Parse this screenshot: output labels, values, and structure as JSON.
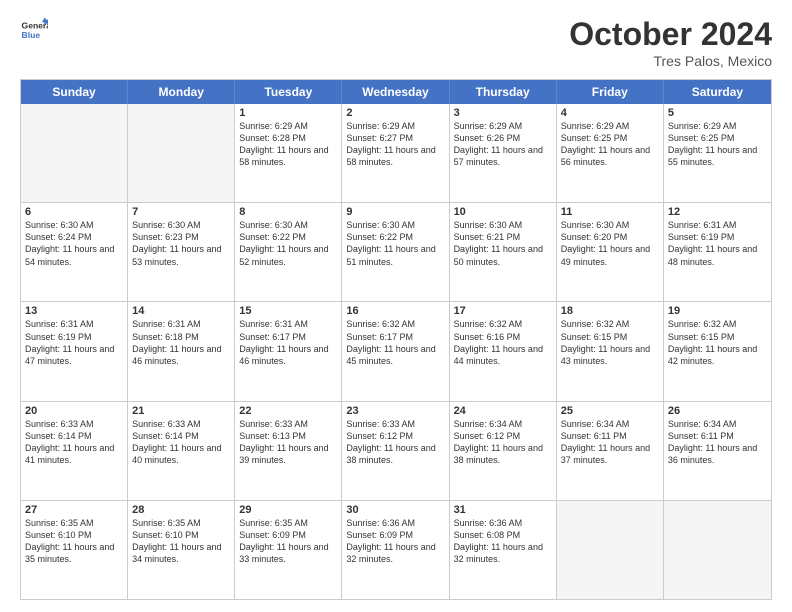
{
  "header": {
    "logo_line1": "General",
    "logo_line2": "Blue",
    "month": "October 2024",
    "location": "Tres Palos, Mexico"
  },
  "day_headers": [
    "Sunday",
    "Monday",
    "Tuesday",
    "Wednesday",
    "Thursday",
    "Friday",
    "Saturday"
  ],
  "weeks": [
    [
      {
        "num": "",
        "empty": true
      },
      {
        "num": "",
        "empty": true
      },
      {
        "num": "1",
        "rise": "6:29 AM",
        "set": "6:28 PM",
        "daylight": "11 hours and 58 minutes."
      },
      {
        "num": "2",
        "rise": "6:29 AM",
        "set": "6:27 PM",
        "daylight": "11 hours and 58 minutes."
      },
      {
        "num": "3",
        "rise": "6:29 AM",
        "set": "6:26 PM",
        "daylight": "11 hours and 57 minutes."
      },
      {
        "num": "4",
        "rise": "6:29 AM",
        "set": "6:25 PM",
        "daylight": "11 hours and 56 minutes."
      },
      {
        "num": "5",
        "rise": "6:29 AM",
        "set": "6:25 PM",
        "daylight": "11 hours and 55 minutes."
      }
    ],
    [
      {
        "num": "6",
        "rise": "6:30 AM",
        "set": "6:24 PM",
        "daylight": "11 hours and 54 minutes."
      },
      {
        "num": "7",
        "rise": "6:30 AM",
        "set": "6:23 PM",
        "daylight": "11 hours and 53 minutes."
      },
      {
        "num": "8",
        "rise": "6:30 AM",
        "set": "6:22 PM",
        "daylight": "11 hours and 52 minutes."
      },
      {
        "num": "9",
        "rise": "6:30 AM",
        "set": "6:22 PM",
        "daylight": "11 hours and 51 minutes."
      },
      {
        "num": "10",
        "rise": "6:30 AM",
        "set": "6:21 PM",
        "daylight": "11 hours and 50 minutes."
      },
      {
        "num": "11",
        "rise": "6:30 AM",
        "set": "6:20 PM",
        "daylight": "11 hours and 49 minutes."
      },
      {
        "num": "12",
        "rise": "6:31 AM",
        "set": "6:19 PM",
        "daylight": "11 hours and 48 minutes."
      }
    ],
    [
      {
        "num": "13",
        "rise": "6:31 AM",
        "set": "6:19 PM",
        "daylight": "11 hours and 47 minutes."
      },
      {
        "num": "14",
        "rise": "6:31 AM",
        "set": "6:18 PM",
        "daylight": "11 hours and 46 minutes."
      },
      {
        "num": "15",
        "rise": "6:31 AM",
        "set": "6:17 PM",
        "daylight": "11 hours and 46 minutes."
      },
      {
        "num": "16",
        "rise": "6:32 AM",
        "set": "6:17 PM",
        "daylight": "11 hours and 45 minutes."
      },
      {
        "num": "17",
        "rise": "6:32 AM",
        "set": "6:16 PM",
        "daylight": "11 hours and 44 minutes."
      },
      {
        "num": "18",
        "rise": "6:32 AM",
        "set": "6:15 PM",
        "daylight": "11 hours and 43 minutes."
      },
      {
        "num": "19",
        "rise": "6:32 AM",
        "set": "6:15 PM",
        "daylight": "11 hours and 42 minutes."
      }
    ],
    [
      {
        "num": "20",
        "rise": "6:33 AM",
        "set": "6:14 PM",
        "daylight": "11 hours and 41 minutes."
      },
      {
        "num": "21",
        "rise": "6:33 AM",
        "set": "6:14 PM",
        "daylight": "11 hours and 40 minutes."
      },
      {
        "num": "22",
        "rise": "6:33 AM",
        "set": "6:13 PM",
        "daylight": "11 hours and 39 minutes."
      },
      {
        "num": "23",
        "rise": "6:33 AM",
        "set": "6:12 PM",
        "daylight": "11 hours and 38 minutes."
      },
      {
        "num": "24",
        "rise": "6:34 AM",
        "set": "6:12 PM",
        "daylight": "11 hours and 38 minutes."
      },
      {
        "num": "25",
        "rise": "6:34 AM",
        "set": "6:11 PM",
        "daylight": "11 hours and 37 minutes."
      },
      {
        "num": "26",
        "rise": "6:34 AM",
        "set": "6:11 PM",
        "daylight": "11 hours and 36 minutes."
      }
    ],
    [
      {
        "num": "27",
        "rise": "6:35 AM",
        "set": "6:10 PM",
        "daylight": "11 hours and 35 minutes."
      },
      {
        "num": "28",
        "rise": "6:35 AM",
        "set": "6:10 PM",
        "daylight": "11 hours and 34 minutes."
      },
      {
        "num": "29",
        "rise": "6:35 AM",
        "set": "6:09 PM",
        "daylight": "11 hours and 33 minutes."
      },
      {
        "num": "30",
        "rise": "6:36 AM",
        "set": "6:09 PM",
        "daylight": "11 hours and 32 minutes."
      },
      {
        "num": "31",
        "rise": "6:36 AM",
        "set": "6:08 PM",
        "daylight": "11 hours and 32 minutes."
      },
      {
        "num": "",
        "empty": true
      },
      {
        "num": "",
        "empty": true
      }
    ]
  ],
  "labels": {
    "sunrise": "Sunrise:",
    "sunset": "Sunset:",
    "daylight": "Daylight:"
  }
}
